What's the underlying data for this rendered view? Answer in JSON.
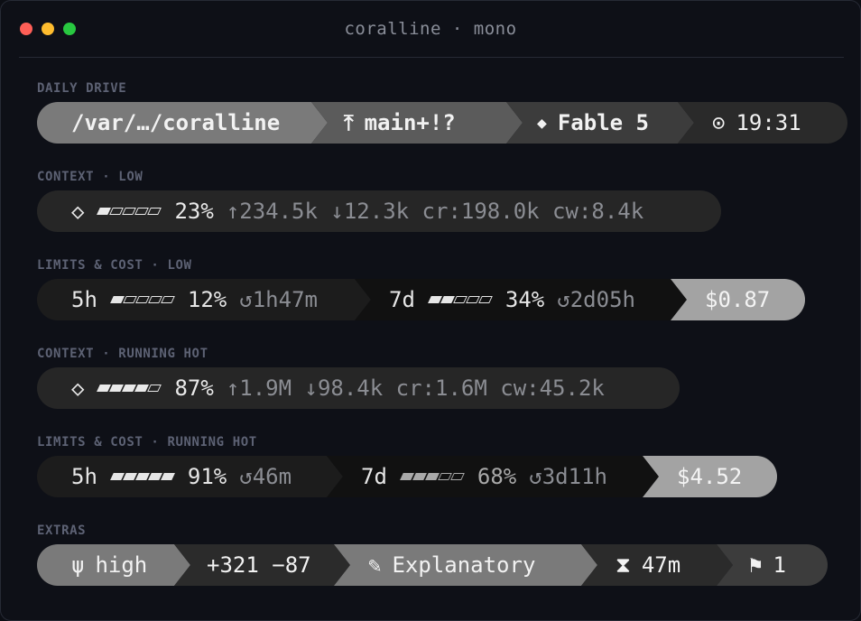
{
  "window": {
    "title": "coralline · mono"
  },
  "sections": {
    "daily_drive": {
      "label": "DAILY DRIVE",
      "path": "/var/…/coralline",
      "git_icon": "branch-icon",
      "git_glyph": "⤒",
      "branch": "main+!?",
      "model_icon": "diamond-icon",
      "model_glyph": "◆",
      "model": "Fable 5",
      "clock_icon": "clock-icon",
      "clock_glyph": "⊙",
      "time": "19:31"
    },
    "context_low": {
      "label": "CONTEXT · LOW",
      "icon_glyph": "◇",
      "meter_filled": 1,
      "meter_total": 5,
      "percent": "23%",
      "stats": "↑234.5k ↓12.3k cr:198.0k cw:8.4k"
    },
    "limits_low": {
      "label": "LIMITS & COST · LOW",
      "five_h_label": "5h",
      "five_h_filled": 1,
      "five_h_pct": "12%",
      "five_h_reset": "↺1h47m",
      "seven_d_label": "7d",
      "seven_d_filled": 2,
      "seven_d_pct": "34%",
      "seven_d_reset": "↺2d05h",
      "cost": "$0.87"
    },
    "context_hot": {
      "label": "CONTEXT · RUNNING HOT",
      "icon_glyph": "◇",
      "meter_filled": 4,
      "meter_total": 5,
      "percent": "87%",
      "stats": "↑1.9M ↓98.4k cr:1.6M cw:45.2k"
    },
    "limits_hot": {
      "label": "LIMITS & COST · RUNNING HOT",
      "five_h_label": "5h",
      "five_h_filled": 5,
      "five_h_pct": "91%",
      "five_h_reset": "↺46m",
      "seven_d_label": "7d",
      "seven_d_filled": 3,
      "seven_d_pct": "68%",
      "seven_d_reset": "↺3d11h",
      "cost": "$4.52"
    },
    "extras": {
      "label": "EXTRAS",
      "effort_glyph": "ψ",
      "effort": "high",
      "lines": "+321 −87",
      "style_glyph": "✎",
      "style": "Explanatory",
      "timer_glyph": "⧗",
      "duration": "47m",
      "flag_glyph": "⚑",
      "flag_count": "1"
    }
  },
  "colors": {
    "segment_light": "#7c7c7c",
    "segment_mid": "#5a5a5a",
    "segment_dark": "#2f2f2f",
    "segment_darker": "#1b1b1b",
    "cost_bg": "#a3a3a3"
  }
}
